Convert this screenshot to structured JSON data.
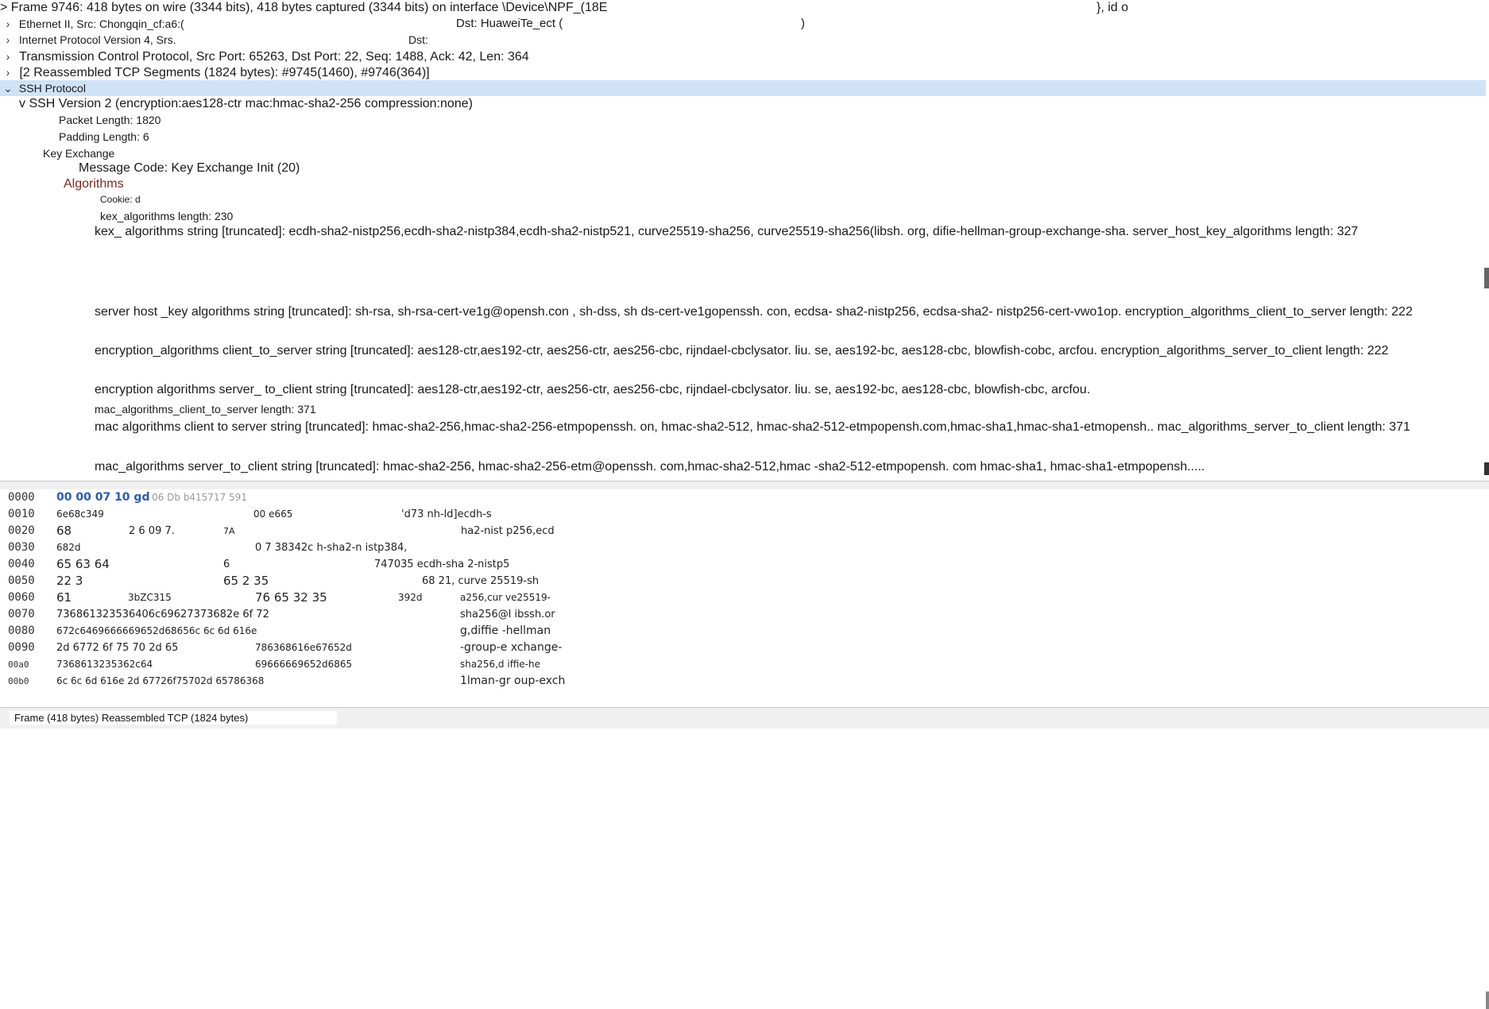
{
  "tree": {
    "frame": "Frame 9746:  418 bytes on wire (3344 bits), 418 bytes captured (3344 bits) on interface \\Device\\NPF_(18E",
    "frame_tail": "},  id o",
    "ethernet": "Ethernet II, Src: Chongqin_cf:a6:(",
    "ethernet_dst_label": "Dst:   HuaweiTe_ect  (",
    "ethernet_close": ")",
    "ip": "Internet Protocol Version 4, Srs.",
    "ip_dst": "Dst:",
    "tcp": "Transmission Control Protocol, Src Port: 65263, Dst Port: 22, Seq: 1488, Ack: 42, Len: 364",
    "reassembled": "[2 Reassembled TCP Segments (1824 bytes): #9745(1460), #9746(364)]",
    "ssh": "SSH Protocol",
    "ssh_version": "v SSH Version 2 (encryption:aes128-ctr mac:hmac-sha2-256 compression:none)",
    "packet_length": "Packet Length: 1820",
    "padding_length": "Padding Length: 6",
    "key_exchange": "Key Exchange",
    "message_code": "Message Code: Key Exchange Init (20)",
    "algorithms": "Algorithms",
    "cookie": "Cookie: d",
    "kex_len": "kex_algorithms length: 230",
    "kex_str": "kex_ algorithms string [truncated]: ecdh-sha2-nistp256,ecdh-sha2-nistp384,ecdh-sha2-nistp521, curve25519-sha256, curve25519-sha256(libsh. org, difie-hellman-group-exchange-sha. server_host_key_algorithms length: 327",
    "hostkey_str": "server host _key algorithms string [truncated]: sh-rsa,  sh-rsa-cert-ve1g@opensh.con , sh-dss, sh ds-cert-ve1gopenssh. con, ecdsa- sha2-nistp256, ecdsa-sha2- nistp256-cert-vwo1op. encryption_algorithms_client_to_server length: 222",
    "enc_c2s_str": "encryption_algorithms client_to_server string [truncated]: aes128-ctr,aes192-ctr, aes256-ctr, aes256-cbc, rijndael-cbclysator. liu. se, aes192-bc, aes128-cbc, blowfish-cobc, arcfou. encryption_algorithms_server_to_client length: 222",
    "enc_s2c_str": "encryption algorithms server_ to_client string [truncated]: aes128-ctr,aes192-ctr, aes256-ctr, aes256-cbc, rijndael-cbclysator. liu. se, aes192-bc, aes128-cbc, blowfish-cbc, arcfou.",
    "mac_c2s_len": " mac_algorithms_client_to_server length: 371",
    "mac_c2s_str": "mac algorithms client to server string [truncated]: hmac-sha2-256,hmac-sha2-256-etmpopenssh. on, hmac-sha2-512, hmac-sha2-512-etmpopensh.com,hmac-sha1,hmac-sha1-etmopensh.. mac_algorithms_server_to_client length:   371",
    "mac_s2c_str": "mac_algorithms server_to_client string [truncated]: hmac-sha2-256, hmac-sha2-256-etm@openssh.  com,hmac-sha2-512,hmac -sha2-512-etmpopensh. com hmac-sha1, hmac-sha1-etmpopensh....."
  },
  "hex": [
    {
      "off": "0000",
      "b1": "00 00 07 10 gd",
      "b1g": "06 Db b415717 591",
      "b2": "",
      "a": ""
    },
    {
      "off": "0010",
      "b1": "6e68c349",
      "b2": "00 e665",
      "b3": "'d73 nh-ld]ecdh-s",
      "a": ""
    },
    {
      "off": "0020",
      "b1": "68",
      "b1b": "2   6  09 7.",
      "b1c": "7A",
      "b2": "",
      "a": "ha2-nist p256,ecd"
    },
    {
      "off": "0030",
      "b1": "682d",
      "b2": "0 7 38342c h-sha2-n istp384,",
      "a": ""
    },
    {
      "off": "0040",
      "b1": "65 63 64",
      "b1b": "6",
      "b2": "747035 ecdh-sha 2-nistp5",
      "a": ""
    },
    {
      "off": "0050",
      "b1": "22 3",
      "b1b": "65   2 35",
      "b2": "68 21, curve 25519-sh",
      "a": ""
    },
    {
      "off": "0060",
      "b1": "61",
      "b1b": "3bZC315",
      "b1c": "76 65 32 35",
      "b2": "392d",
      "a": "a256,cur ve25519-"
    },
    {
      "off": "0070",
      "b1": "736861323536406c69627373682e 6f 72",
      "b2": "",
      "a": "sha256@l  ibssh.or"
    },
    {
      "off": "0080",
      "b1": "672c6469666669652d68656c 6c 6d 616e",
      "b2": "",
      "a": "g,diffie -hellman"
    },
    {
      "off": "0090",
      "b1": "2d 6772 6f 75 70 2d 65",
      "b2": "786368616e67652d",
      "a": "-group-e xchange-"
    },
    {
      "off": "00a0",
      "b1": "7368613235362c64",
      "b2": "69666669652d6865",
      "a": "sha256,d iffie-he"
    },
    {
      "off": "00b0",
      "b1": "6c 6c 6d 616e 2d 67726f75702d 65786368",
      "b2": "",
      "a": "1lman-gr oup-exch"
    }
  ],
  "status": {
    "text": "Frame (418 bytes) Reassembled TCP (1824 bytes)"
  }
}
